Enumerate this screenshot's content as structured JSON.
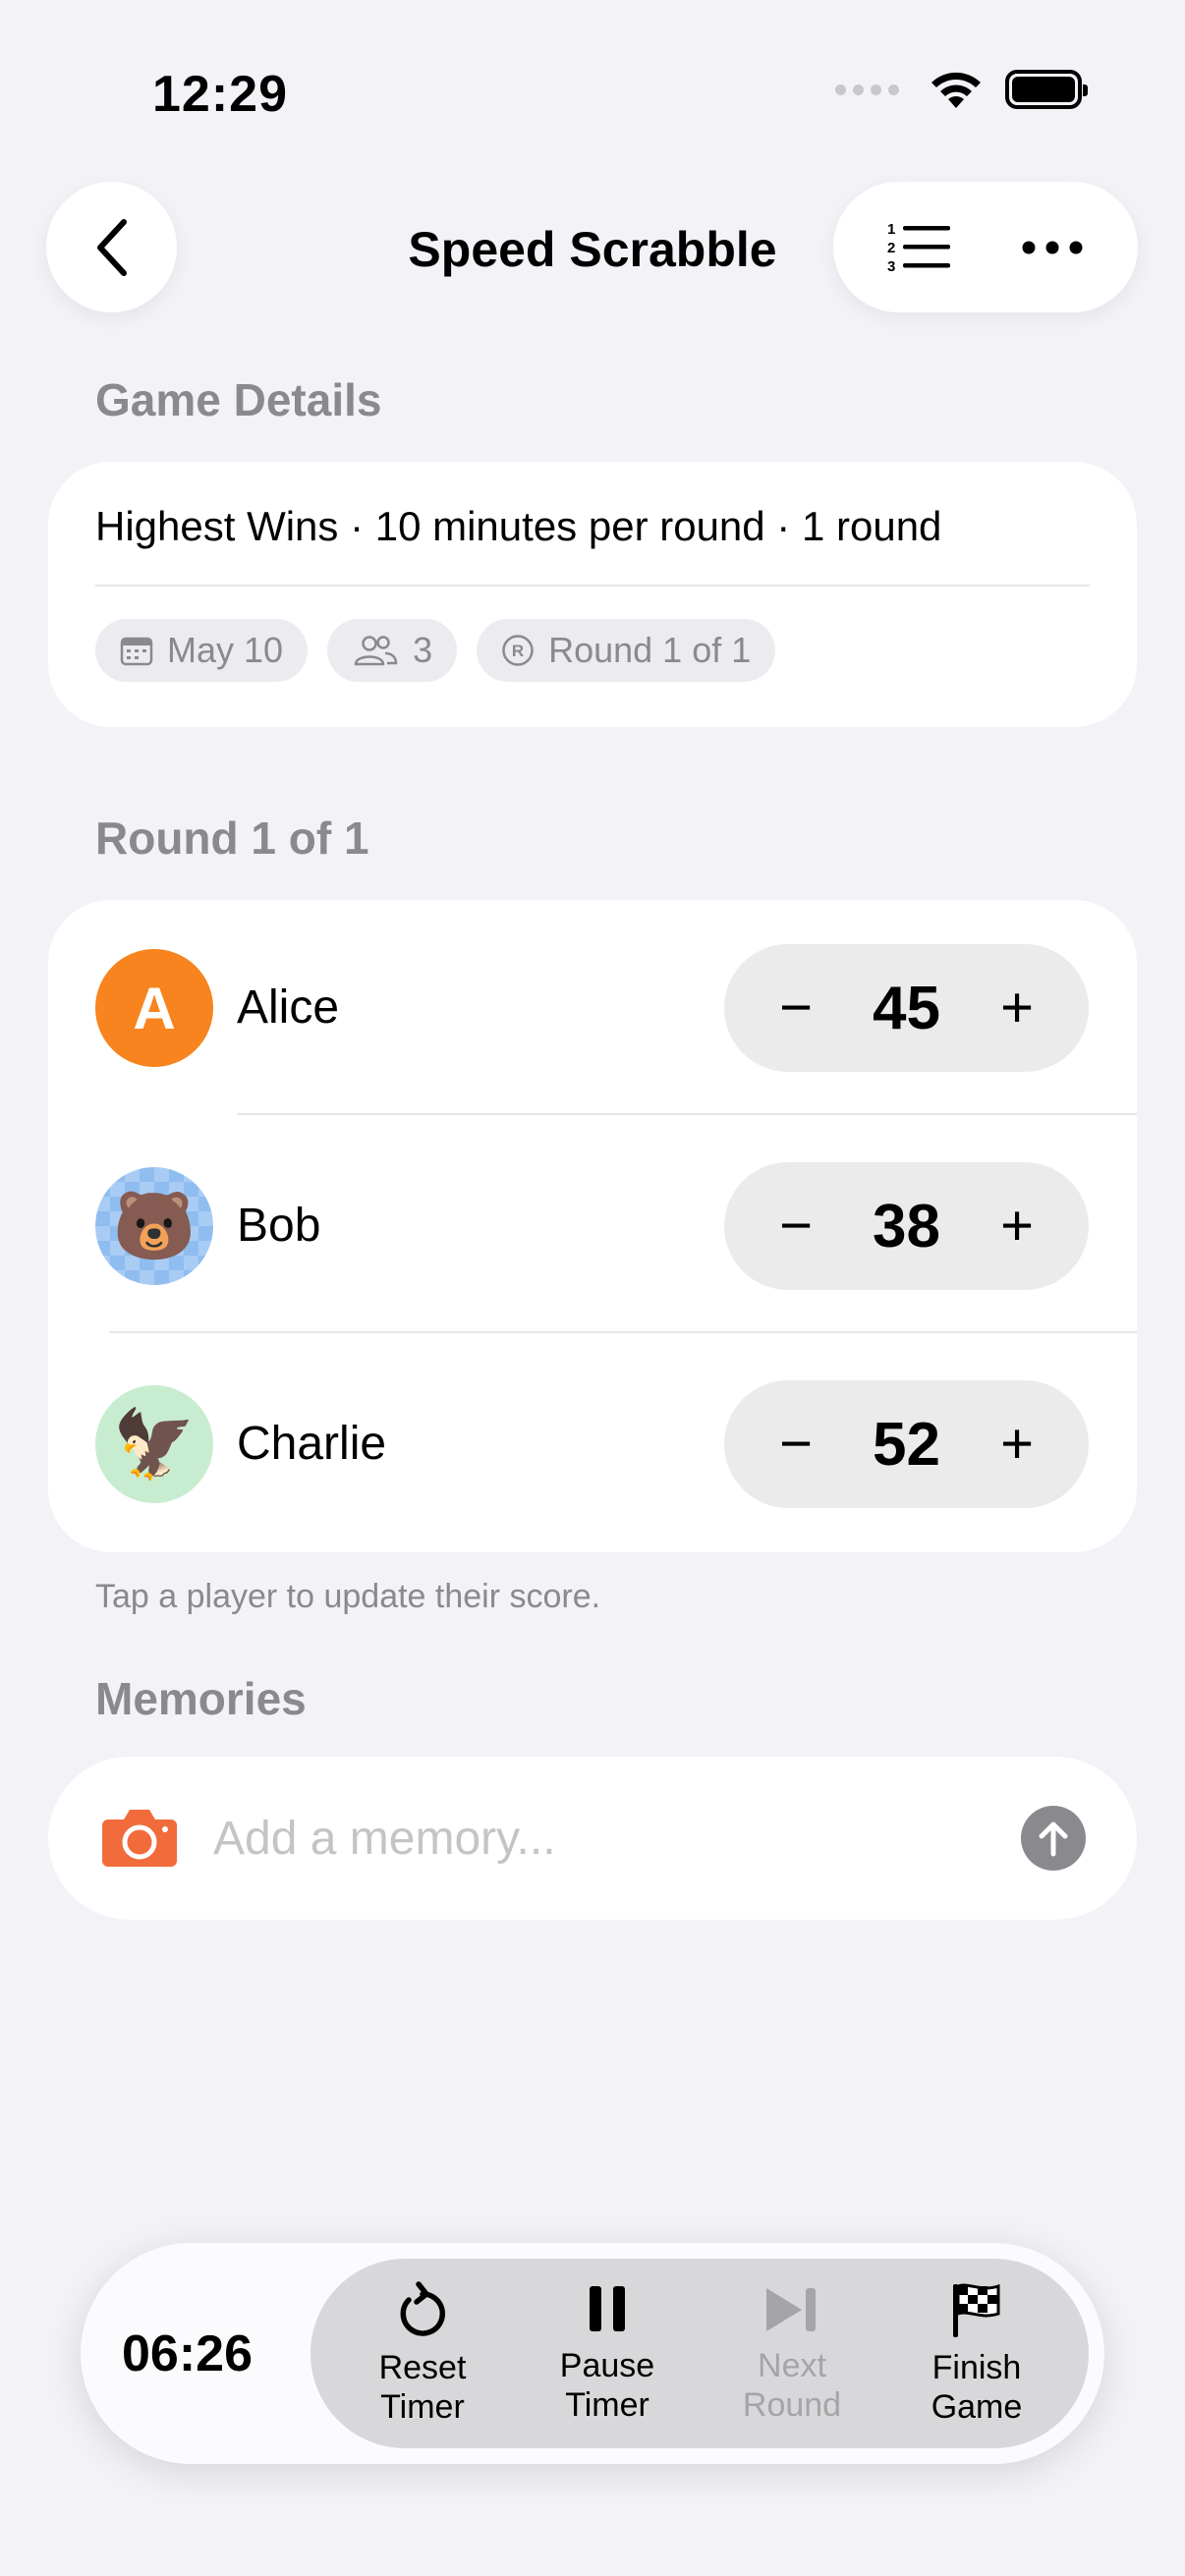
{
  "status": {
    "time": "12:29"
  },
  "nav": {
    "title": "Speed Scrabble"
  },
  "details": {
    "header": "Game Details",
    "summary": "Highest Wins · 10 minutes per round · 1 round",
    "chips": {
      "date": "May 10",
      "players": "3",
      "round": "Round 1 of 1"
    }
  },
  "round": {
    "header": "Round 1 of 1",
    "players": [
      {
        "name": "Alice",
        "initial": "A",
        "score": "45",
        "avatar_color": "#f7841e"
      },
      {
        "name": "Bob",
        "emoji": "🐻",
        "score": "38"
      },
      {
        "name": "Charlie",
        "emoji": "🦅",
        "score": "52"
      }
    ],
    "minus": "−",
    "plus": "+",
    "hint": "Tap a player to update their score."
  },
  "memories": {
    "header": "Memories",
    "placeholder": "Add a memory..."
  },
  "bottom": {
    "timer": "06:26",
    "actions": [
      {
        "label": "Reset\nTimer"
      },
      {
        "label": "Pause\nTimer"
      },
      {
        "label": "Next\nRound"
      },
      {
        "label": "Finish\nGame"
      }
    ]
  },
  "colors": {
    "accent_orange": "#f7841e",
    "camera": "#f26b3a",
    "background": "#f2f2f7"
  }
}
